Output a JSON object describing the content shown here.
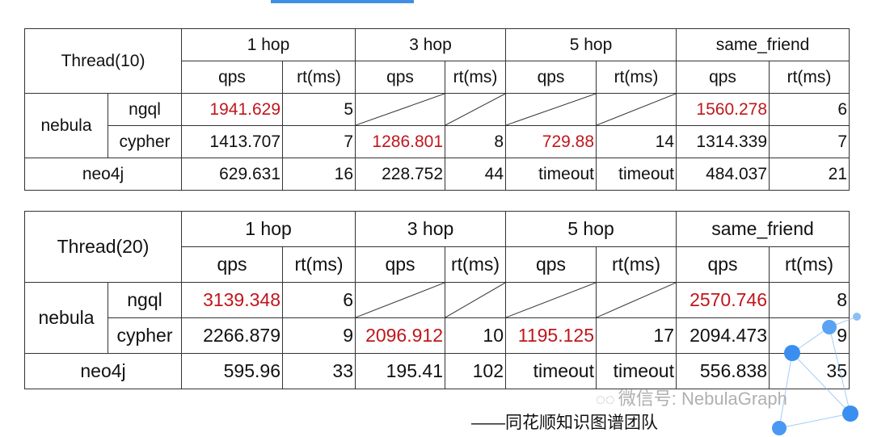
{
  "table1": {
    "thread": "Thread(10)",
    "groups": [
      "1 hop",
      "3 hop",
      "5 hop",
      "same_friend"
    ],
    "subheaders": [
      "qps",
      "rt(ms)",
      "qps",
      "rt(ms)",
      "qps",
      "rt(ms)",
      "qps",
      "rt(ms)"
    ],
    "nebula_label": "nebula",
    "neo4j_label": "neo4j",
    "ngql_label": "ngql",
    "cypher_label": "cypher",
    "ngql": [
      "1941.629",
      "5",
      "",
      "",
      "",
      "",
      "1560.278",
      "6"
    ],
    "cypher": [
      "1413.707",
      "7",
      "1286.801",
      "8",
      "729.88",
      "14",
      "1314.339",
      "7"
    ],
    "neo4j": [
      "629.631",
      "16",
      "228.752",
      "44",
      "timeout",
      "timeout",
      "484.037",
      "21"
    ]
  },
  "table2": {
    "thread": "Thread(20)",
    "groups": [
      "1 hop",
      "3 hop",
      "5 hop",
      "same_friend"
    ],
    "subheaders": [
      "qps",
      "rt(ms)",
      "qps",
      "rt(ms)",
      "qps",
      "rt(ms)",
      "qps",
      "rt(ms)"
    ],
    "nebula_label": "nebula",
    "neo4j_label": "neo4j",
    "ngql_label": "ngql",
    "cypher_label": "cypher",
    "ngql": [
      "3139.348",
      "6",
      "",
      "",
      "",
      "",
      "2570.746",
      "8"
    ],
    "cypher": [
      "2266.879",
      "9",
      "2096.912",
      "10",
      "1195.125",
      "17",
      "2094.473",
      "9"
    ],
    "neo4j": [
      "595.96",
      "33",
      "195.41",
      "102",
      "timeout",
      "timeout",
      "556.838",
      "35"
    ]
  },
  "watermark": "微信号: NebulaGraph",
  "credit": "——同花顺知识图谱团队",
  "colors": {
    "highlight": "#c0161c",
    "border": "#333333",
    "accent": "#3f8fe6"
  }
}
